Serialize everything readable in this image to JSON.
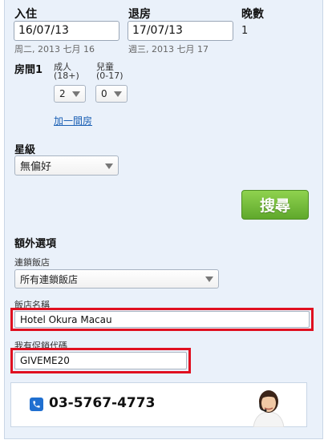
{
  "checkin": {
    "label": "入住",
    "value": "16/07/13",
    "subtext": "周二, 2013 七月 16"
  },
  "checkout": {
    "label": "退房",
    "value": "17/07/13",
    "subtext": "週三, 2013 七月 17"
  },
  "nights": {
    "label": "晚數",
    "value": "1"
  },
  "room": {
    "label": "房間1",
    "adults_label": "成人",
    "adults_age": "(18+)",
    "adults_value": "2",
    "children_label": "兒童",
    "children_age": "(0-17)",
    "children_value": "0",
    "add_room_link": "加一間房"
  },
  "star_rating": {
    "label": "星級",
    "value": "無偏好"
  },
  "search_button": "搜尋",
  "extras": {
    "heading": "額外選項",
    "chain_label": "連鎖飯店",
    "chain_value": "所有連鎖飯店",
    "hotel_name_label": "飯店名稱",
    "hotel_name_value": "Hotel Okura Macau",
    "promo_label": "我有促銷代碼",
    "promo_value": "GIVEME20"
  },
  "support": {
    "phone": "03-5767-4773"
  },
  "colors": {
    "highlight": "#e01020",
    "search_button": "#6fb83a",
    "panel_bg": "#eaf1fa"
  }
}
